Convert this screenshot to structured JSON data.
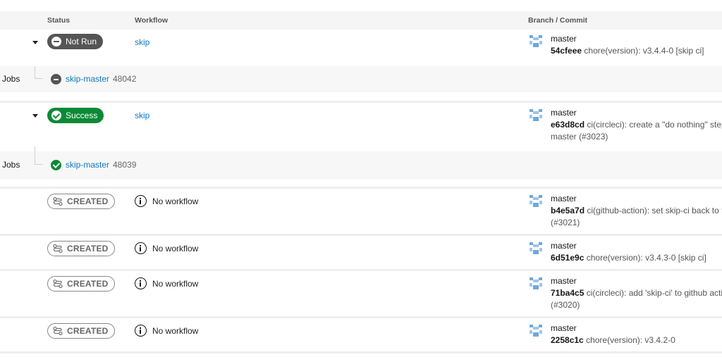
{
  "header": {
    "status": "Status",
    "workflow": "Workflow",
    "branch_commit": "Branch / Commit"
  },
  "colors": {
    "success": "#0b8a36",
    "not_run": "#555555",
    "link": "#0d7bbf",
    "created_border": "#888888"
  },
  "pipelines": [
    {
      "status": "Not Run",
      "workflow": "skip",
      "branch": "master",
      "sha": "54cfeee",
      "message": "chore(version): v3.4.4-0 [skip ci]",
      "jobs": {
        "label": "Jobs",
        "name": "skip-master",
        "number": "48042",
        "icon": "not-run-icon"
      }
    },
    {
      "status": "Success",
      "workflow": "skip",
      "branch": "master",
      "sha": "e63d8cd",
      "message": "ci(circleci): create a \"do nothing\" step f",
      "message_line2": "master (#3023)",
      "jobs": {
        "label": "Jobs",
        "name": "skip-master",
        "number": "48039",
        "icon": "success-icon"
      }
    },
    {
      "status": "CREATED",
      "workflow": "No workflow",
      "branch": "master",
      "sha": "b4e5a7d",
      "message": "ci(github-action): set skip-ci back to fa",
      "message_line2": "(#3021)"
    },
    {
      "status": "CREATED",
      "workflow": "No workflow",
      "branch": "master",
      "sha": "6d51e9c",
      "message": "chore(version): v3.4.3-0 [skip ci]"
    },
    {
      "status": "CREATED",
      "workflow": "No workflow",
      "branch": "master",
      "sha": "71ba4c5",
      "message": "ci(circleci): add 'skip-ci' to github actio",
      "message_line2": "(#3020)"
    },
    {
      "status": "CREATED",
      "workflow": "No workflow",
      "branch": "master",
      "sha": "2258c1c",
      "message": "chore(version): v3.4.2-0"
    }
  ]
}
